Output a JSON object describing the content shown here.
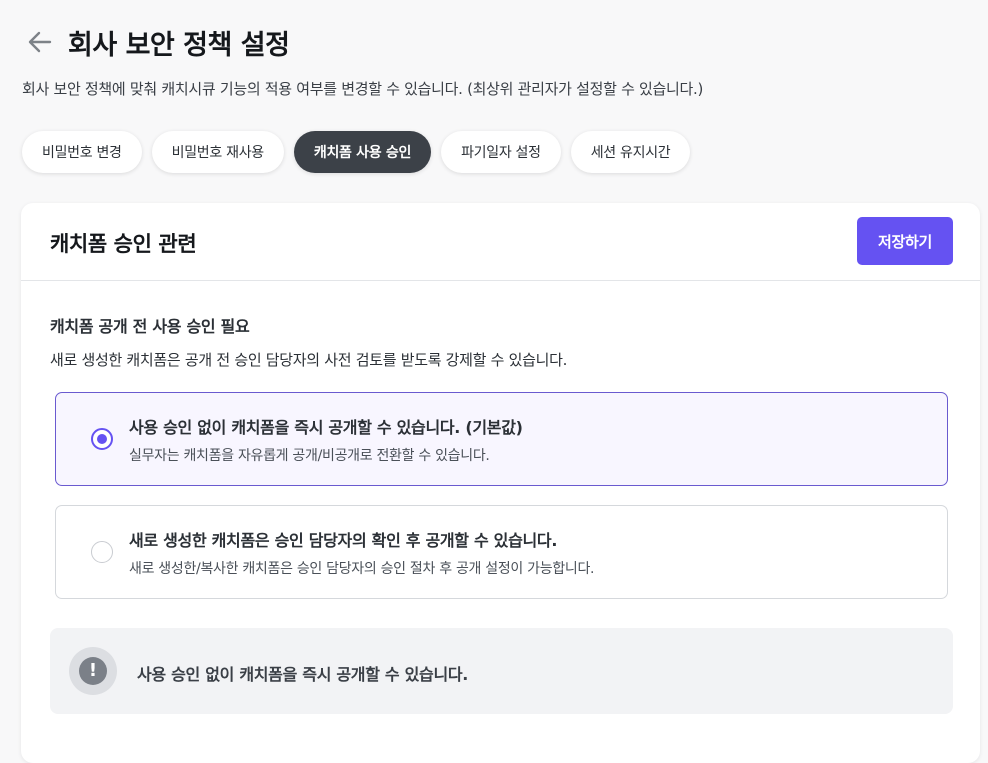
{
  "header": {
    "title": "회사 보안 정책 설정",
    "description": "회사 보안 정책에 맞춰 캐치시큐 기능의 적용 여부를 변경할 수 있습니다. (최상위 관리자가 설정할 수 있습니다.)",
    "back_icon": "arrow-left-icon"
  },
  "tabs": [
    {
      "label": "비밀번호 변경",
      "active": false
    },
    {
      "label": "비밀번호 재사용",
      "active": false
    },
    {
      "label": "캐치폼 사용 승인",
      "active": true
    },
    {
      "label": "파기일자 설정",
      "active": false
    },
    {
      "label": "세션 유지시간",
      "active": false
    }
  ],
  "card": {
    "title": "캐치폼 승인 관련",
    "save_label": "저장하기",
    "section_title": "캐치폼 공개 전 사용 승인 필요",
    "section_desc": "새로 생성한 캐치폼은 공개 전 승인 담당자의 사전 검토를 받도록 강제할 수 있습니다.",
    "options": [
      {
        "title": "사용 승인 없이 캐치폼을 즉시 공개할 수 있습니다. (기본값)",
        "desc": "실무자는 캐치폼을 자유롭게 공개/비공개로 전환할 수 있습니다.",
        "selected": true
      },
      {
        "title": "새로 생성한 캐치폼은 승인 담당자의 확인 후 공개할 수 있습니다.",
        "desc": "새로 생성한/복사한 캐치폼은 승인 담당자의 승인 절차 후 공개 설정이 가능합니다.",
        "selected": false
      }
    ],
    "notice": {
      "icon": "exclamation-icon",
      "icon_glyph": "!",
      "text": "사용 승인 없이 캐치폼을 즉시 공개할 수 있습니다."
    }
  },
  "colors": {
    "accent": "#6552f2",
    "active_tab": "#3c4148",
    "background": "#f8f8f9"
  }
}
